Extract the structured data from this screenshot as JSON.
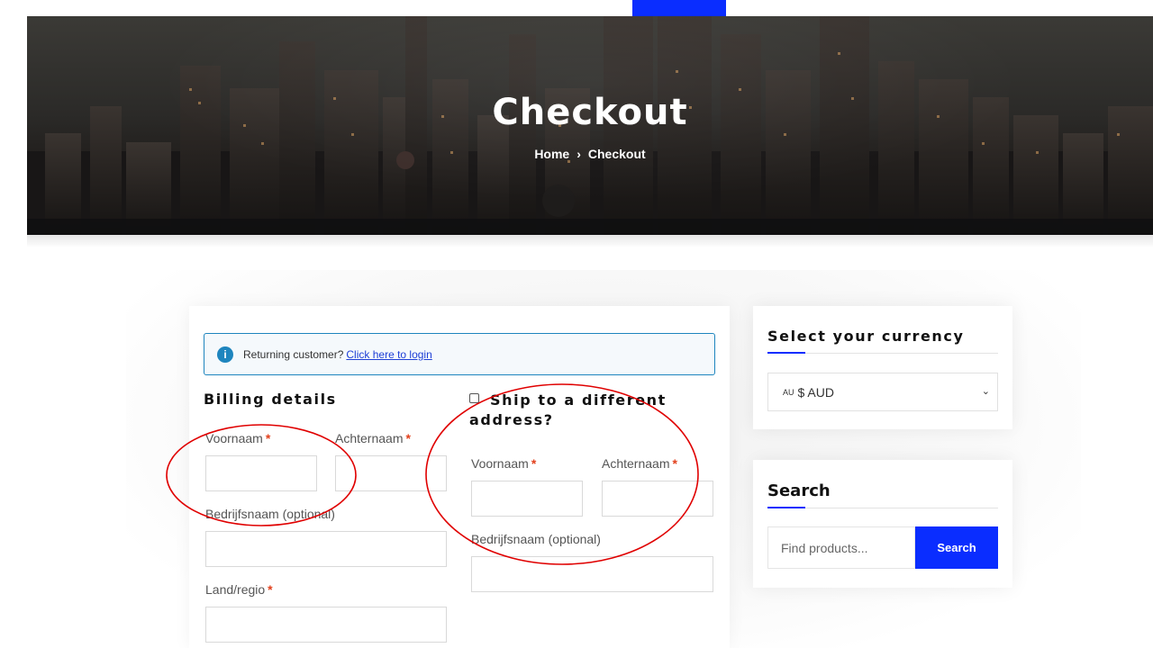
{
  "hero": {
    "title": "Checkout",
    "breadcrumb": {
      "home": "Home",
      "separator": "›",
      "current": "Checkout"
    }
  },
  "notice": {
    "icon": "info-icon",
    "text": "Returning customer?",
    "link": "Click here to login"
  },
  "billing": {
    "title": "Billing details",
    "first_name_label": "Voornaam",
    "last_name_label": "Achternaam",
    "company_label": "Bedrijfsnaam (optional)",
    "country_label": "Land/regio",
    "required_mark": "*"
  },
  "shipping": {
    "checkbox_label_line1": "Ship to a different",
    "checkbox_label_line2": "address?",
    "first_name_label": "Voornaam",
    "last_name_label": "Achternaam",
    "company_label": "Bedrijfsnaam (optional)",
    "required_mark": "*"
  },
  "currency_widget": {
    "title": "Select your currency",
    "selected_flag": "AU",
    "selected_value": "$ AUD"
  },
  "search_widget": {
    "title": "Search",
    "placeholder": "Find products...",
    "button_label": "Search"
  },
  "colors": {
    "accent": "#0a2dff",
    "notice_border": "#1e85be",
    "required": "#e2401c",
    "annotation": "#e00000"
  }
}
